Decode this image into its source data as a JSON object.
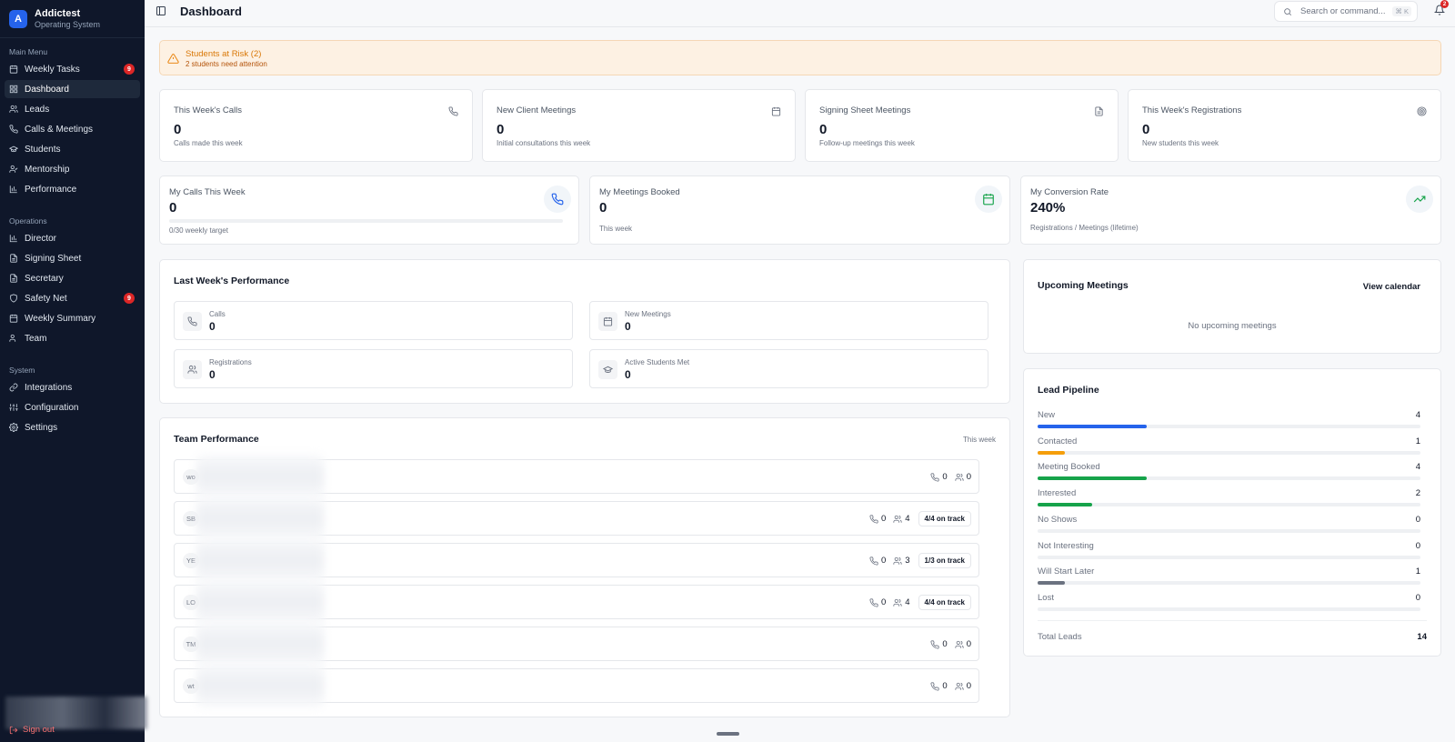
{
  "brand": {
    "logo_letter": "A",
    "name": "Addictest",
    "subtitle": "Operating System"
  },
  "sidebar": {
    "sections": [
      {
        "title": "Main Menu",
        "items": [
          {
            "label": "Weekly Tasks",
            "icon": "calendar-icon",
            "badge": "9"
          },
          {
            "label": "Dashboard",
            "icon": "grid-icon",
            "active": true
          },
          {
            "label": "Leads",
            "icon": "users-icon"
          },
          {
            "label": "Calls & Meetings",
            "icon": "phone-icon"
          },
          {
            "label": "Students",
            "icon": "graduation-cap-icon"
          },
          {
            "label": "Mentorship",
            "icon": "user-check-icon"
          },
          {
            "label": "Performance",
            "icon": "bar-chart-icon"
          }
        ]
      },
      {
        "title": "Operations",
        "items": [
          {
            "label": "Director",
            "icon": "bar-chart-icon"
          },
          {
            "label": "Signing Sheet",
            "icon": "file-icon"
          },
          {
            "label": "Secretary",
            "icon": "file-icon"
          },
          {
            "label": "Safety Net",
            "icon": "shield-icon",
            "badge": "9"
          },
          {
            "label": "Weekly Summary",
            "icon": "calendar-icon"
          },
          {
            "label": "Team",
            "icon": "users-icon"
          }
        ]
      },
      {
        "title": "System",
        "items": [
          {
            "label": "Integrations",
            "icon": "link-icon"
          },
          {
            "label": "Configuration",
            "icon": "sliders-icon"
          },
          {
            "label": "Settings",
            "icon": "gear-icon"
          }
        ]
      }
    ],
    "sign_out": "Sign out"
  },
  "header": {
    "title": "Dashboard",
    "search_placeholder": "Search or command...",
    "shortcut": "⌘ K",
    "notification_count": "2"
  },
  "alert": {
    "title": "Students at Risk (2)",
    "subtitle": "2 students need attention"
  },
  "stats": [
    {
      "label": "This Week's Calls",
      "value": "0",
      "sub": "Calls made this week",
      "icon": "phone-icon"
    },
    {
      "label": "New Client Meetings",
      "value": "0",
      "sub": "Initial consultations this week",
      "icon": "calendar-icon"
    },
    {
      "label": "Signing Sheet Meetings",
      "value": "0",
      "sub": "Follow-up meetings this week",
      "icon": "file-icon"
    },
    {
      "label": "This Week's Registrations",
      "value": "0",
      "sub": "New students this week",
      "icon": "target-icon"
    }
  ],
  "my_stats": [
    {
      "label": "My Calls This Week",
      "value": "0",
      "sub": "0/30 weekly target",
      "progress": 0,
      "icon": "phone-icon",
      "color": "#2563eb"
    },
    {
      "label": "My Meetings Booked",
      "value": "0",
      "sub": "This week",
      "icon": "calendar-icon",
      "color": "#16a34a"
    },
    {
      "label": "My Conversion Rate",
      "value": "240%",
      "sub": "Registrations / Meetings (lifetime)",
      "icon": "trending-up-icon",
      "color": "#16a34a"
    }
  ],
  "last_week": {
    "title": "Last Week's Performance",
    "items": [
      {
        "label": "Calls",
        "value": "0",
        "icon": "phone-icon"
      },
      {
        "label": "New Meetings",
        "value": "0",
        "icon": "calendar-icon"
      },
      {
        "label": "Registrations",
        "value": "0",
        "icon": "users-icon"
      },
      {
        "label": "Active Students Met",
        "value": "0",
        "icon": "graduation-cap-icon"
      }
    ]
  },
  "team": {
    "title": "Team Performance",
    "period": "This week",
    "rows": [
      {
        "initials": "wo",
        "calls": "0",
        "meetings": "0",
        "track": ""
      },
      {
        "initials": "SB",
        "calls": "0",
        "meetings": "4",
        "track": "4/4 on track"
      },
      {
        "initials": "YE",
        "calls": "0",
        "meetings": "3",
        "track": "1/3 on track"
      },
      {
        "initials": "LO",
        "calls": "0",
        "meetings": "4",
        "track": "4/4 on track"
      },
      {
        "initials": "TM",
        "calls": "0",
        "meetings": "0",
        "track": ""
      },
      {
        "initials": "wt",
        "calls": "0",
        "meetings": "0",
        "track": ""
      }
    ]
  },
  "upcoming": {
    "title": "Upcoming Meetings",
    "action": "View calendar",
    "empty": "No upcoming meetings"
  },
  "pipeline": {
    "title": "Lead Pipeline",
    "stages": [
      {
        "label": "New",
        "value": "4",
        "fraction": 0.286,
        "color": "#2563eb"
      },
      {
        "label": "Contacted",
        "value": "1",
        "fraction": 0.071,
        "color": "#f59e0b"
      },
      {
        "label": "Meeting Booked",
        "value": "4",
        "fraction": 0.286,
        "color": "#16a34a"
      },
      {
        "label": "Interested",
        "value": "2",
        "fraction": 0.143,
        "color": "#16a34a"
      },
      {
        "label": "No Shows",
        "value": "0",
        "fraction": 0,
        "color": "#9ca3af"
      },
      {
        "label": "Not Interesting",
        "value": "0",
        "fraction": 0,
        "color": "#9ca3af"
      },
      {
        "label": "Will Start Later",
        "value": "1",
        "fraction": 0.071,
        "color": "#6b7280"
      },
      {
        "label": "Lost",
        "value": "0",
        "fraction": 0,
        "color": "#9ca3af"
      }
    ],
    "total_label": "Total Leads",
    "total_value": "14"
  }
}
